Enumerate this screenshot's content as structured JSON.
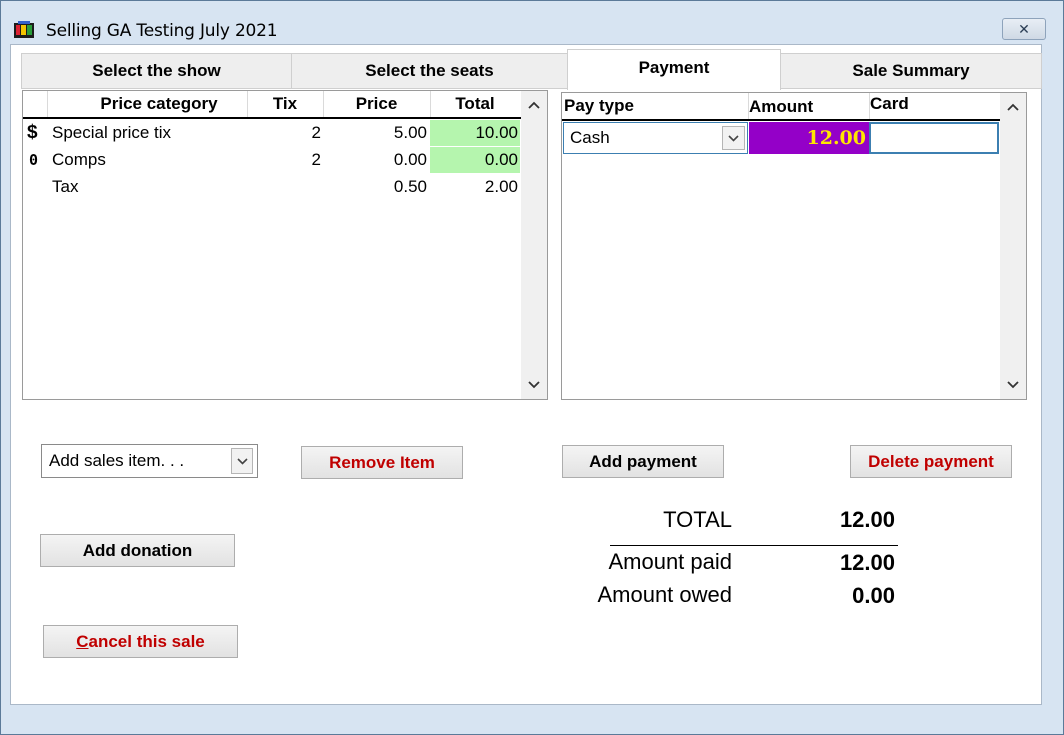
{
  "window": {
    "title": "Selling GA Testing July 2021",
    "close_glyph": "✕"
  },
  "tabs": [
    {
      "label": "Select the show",
      "active": false
    },
    {
      "label": "Select the seats",
      "active": false
    },
    {
      "label": "Payment",
      "active": true
    },
    {
      "label": "Sale Summary",
      "active": false
    }
  ],
  "items_table": {
    "columns": [
      "Price category",
      "Tix",
      "Price",
      "Total"
    ],
    "rows": [
      {
        "icon": "$",
        "category": "Special price tix",
        "tix": "2",
        "price": "5.00",
        "total": "10.00"
      },
      {
        "icon": "0",
        "category": "Comps",
        "tix": "2",
        "price": "0.00",
        "total": "0.00"
      },
      {
        "icon": "",
        "category": "Tax",
        "tix": "",
        "price": "0.50",
        "total": "2.00"
      }
    ]
  },
  "payment_table": {
    "columns": [
      "Pay type",
      "Amount",
      "Card"
    ],
    "rows": [
      {
        "pay_type": "Cash",
        "amount": "12.00",
        "card": ""
      }
    ]
  },
  "controls": {
    "add_sales_item": "Add sales item. . .",
    "remove_item": "Remove Item",
    "add_payment": "Add payment",
    "delete_payment": "Delete payment",
    "add_donation": "Add donation",
    "cancel_sale_first": "C",
    "cancel_sale_rest": "ancel this sale"
  },
  "summary": {
    "total_label": "TOTAL",
    "total_value": "12.00",
    "paid_label": "Amount paid",
    "paid_value": "12.00",
    "owed_label": "Amount owed",
    "owed_value": "0.00"
  },
  "colors": {
    "total_highlight": "#b5f5ae",
    "amount_cell_bg": "#9400c8",
    "amount_cell_text": "#ffe600",
    "danger_text": "#c00000",
    "window_frame": "#d7e4f2"
  }
}
